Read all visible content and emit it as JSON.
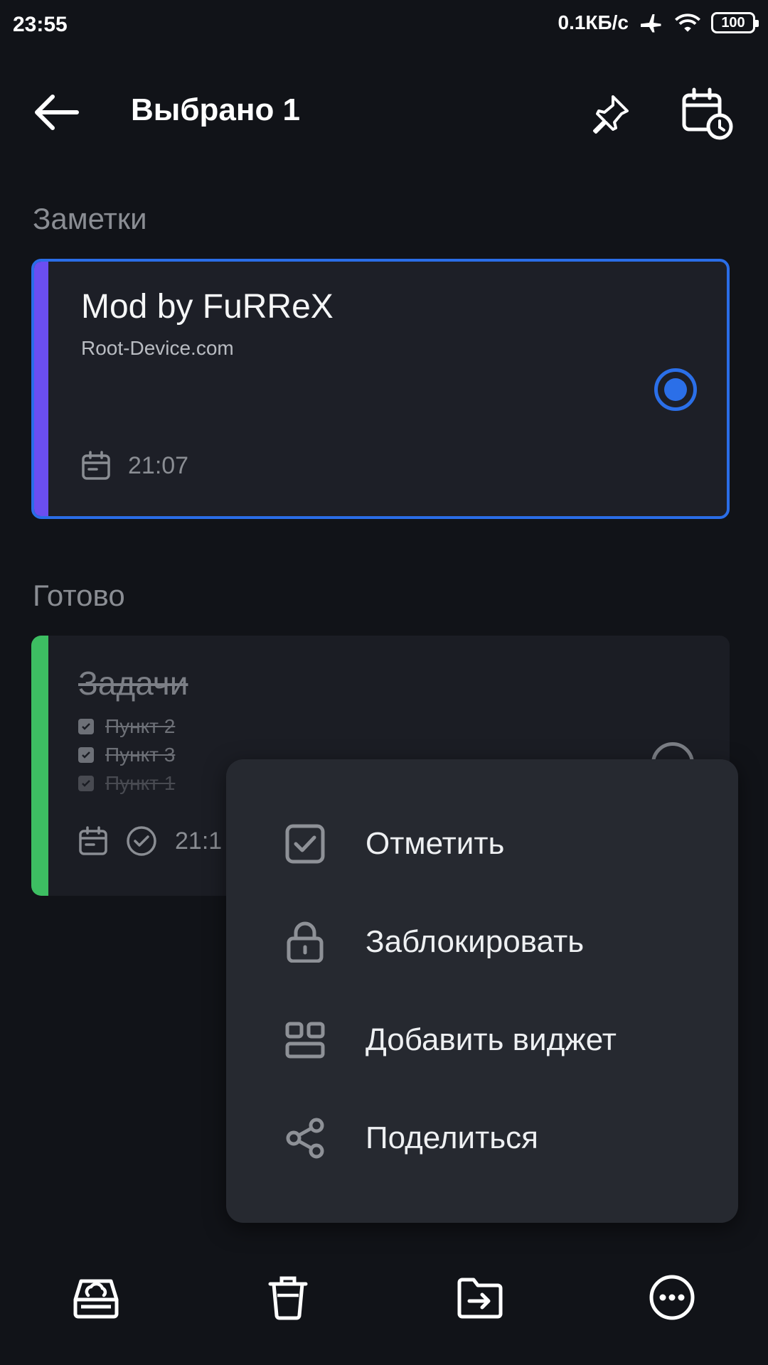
{
  "status_bar": {
    "time": "23:55",
    "network_speed": "0.1КБ/с",
    "battery": "100"
  },
  "top_bar": {
    "title": "Выбрано 1"
  },
  "sections": {
    "notes_label": "Заметки",
    "done_label": "Готово"
  },
  "note_card": {
    "title": "Mod by FuRReX",
    "subtitle": "Root-Device.com",
    "time": "21:07",
    "accent_color": "#6b4ef0",
    "selected": true
  },
  "task_card": {
    "title": "Задачи",
    "items": [
      "Пункт 2",
      "Пункт 3",
      "Пункт 1"
    ],
    "time": "21:1",
    "accent_color": "#3dbe62"
  },
  "context_menu": {
    "items": [
      {
        "label": "Отметить",
        "icon": "checkbox-icon"
      },
      {
        "label": "Заблокировать",
        "icon": "lock-icon"
      },
      {
        "label": "Добавить виджет",
        "icon": "widget-icon"
      },
      {
        "label": "Поделиться",
        "icon": "share-icon"
      }
    ]
  },
  "colors": {
    "background": "#111318",
    "selection": "#2b6fe8",
    "menu_bg": "#262930"
  }
}
